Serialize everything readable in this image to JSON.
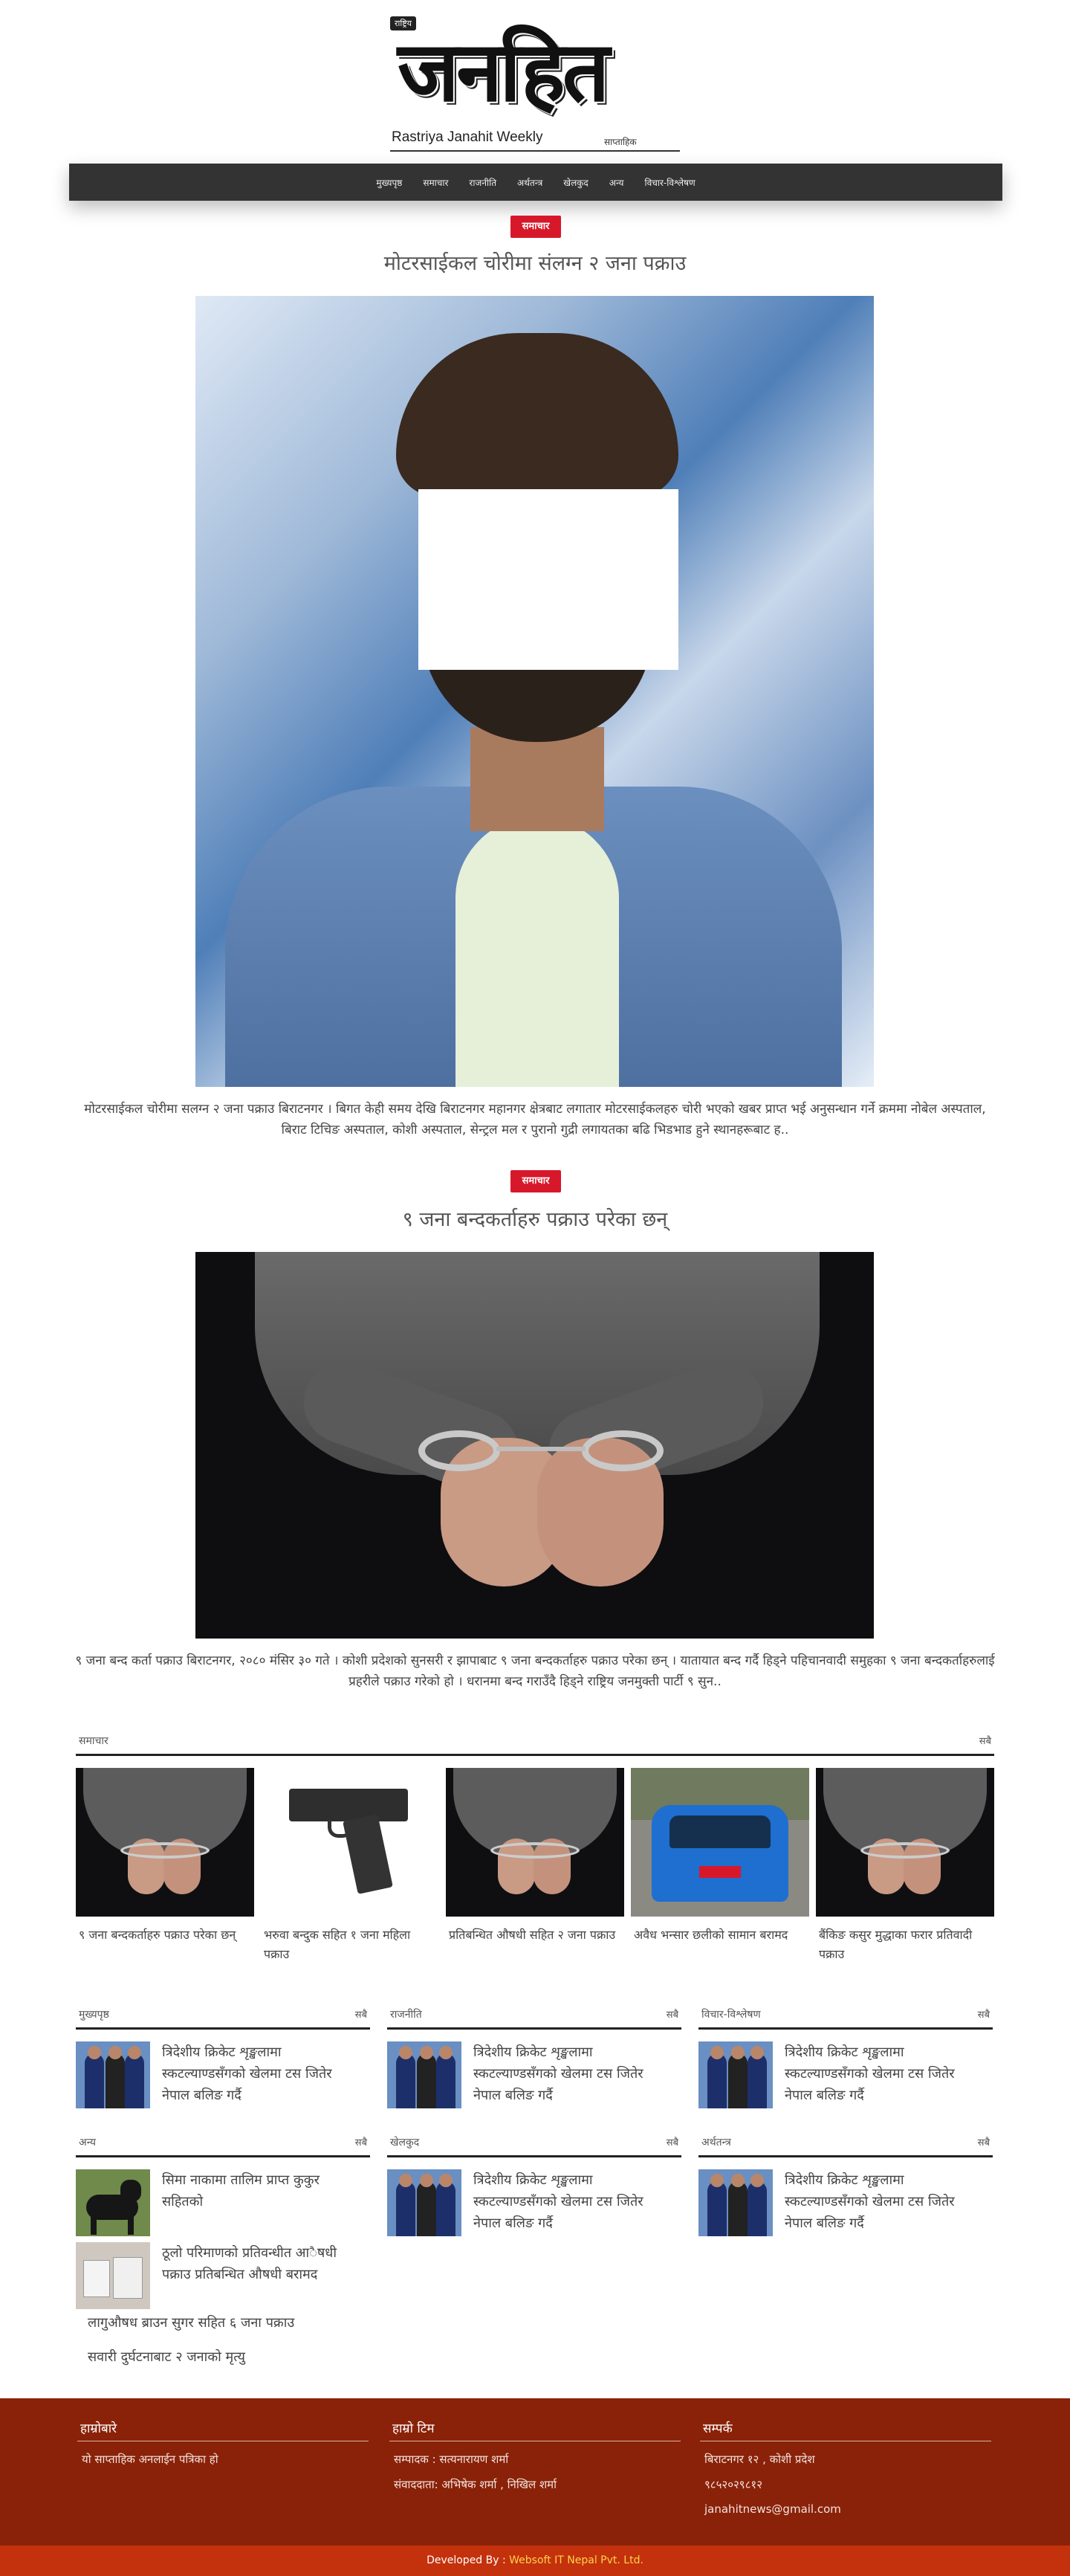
{
  "site": {
    "masthead_prefix": "राष्ट्रिय",
    "masthead_title": "जनहित",
    "masthead_subtitle": "Rastriya Janahit Weekly",
    "masthead_week": "साप्ताहिक"
  },
  "nav": {
    "items": [
      "मुख्यपृष्ठ",
      "समाचार",
      "राजनीति",
      "अर्थतन्त्र",
      "खेलकुद",
      "अन्य",
      "विचार-विश्लेषण"
    ]
  },
  "features": [
    {
      "category": "समाचार",
      "headline": "मोटरसाईकल चोरीमा संलग्न २ जना पक्राउ",
      "excerpt": "मोटरसाईकल चोरीमा सलग्न २ जना पक्राउ बिराटनगर । बिगत केही समय देखि  बिराटनगर महानगर क्षेत्रबाट लगातार मोटरसाईकलहरु चोरी भएको खबर प्राप्त भई अनुसन्धान गर्ने क्रममा नोबेल अस्पताल, बिराट टिचिङ अस्पताल, कोशी अस्पताल, सेन्ट्रल मल र पुरानो गुद्री लगायतका बढि भिडभाड हुने स्थानहरूबाट ह.."
    },
    {
      "category": "समाचार",
      "headline": "९ जना बन्दकर्ताहरु पक्राउ परेका छन्",
      "excerpt": "९ जना बन्द कर्ता पक्राउ   बिराटनगर, २०८० मंसिर ३० गते । कोशी प्रदेशको सुनसरी र झापाबाट ९ जना बन्दकर्ताहरु पक्राउ परेका छन् । यातायात बन्द गर्दै हिड्ने पहिचानवादी समुहका ९ जना बन्दकर्ताहरुलाई प्रहरीले पक्राउ गरेको हो । धरानमा बन्द गराउँदै हिड्ने  राष्ट्रिय जनमुक्ती पार्टी ९ सुन.."
    }
  ],
  "sections": {
    "news": {
      "title": "समाचार",
      "all_label": "सबै",
      "cards": [
        "९ जना बन्दकर्ताहरु पक्राउ परेका छन्",
        "भरुवा बन्दुक सहित १ जना महिला पक्राउ",
        "प्रतिबन्धित औषधी सहित २ जना पक्राउ",
        "अवैध भन्सार छलीको सामान बरामद",
        "बैंकिङ कसुर मुद्धाका फरार प्रतिवादी पक्राउ"
      ]
    },
    "homepage": {
      "title": "मुख्यपृष्ठ",
      "all_label": "सबै",
      "item": "त्रिदेशीय क्रिकेट शृङ्खलामा स्कटल्याण्डसँगको खेलमा टस जितेर नेपाल बलिङ गर्दै"
    },
    "politics": {
      "title": "राजनीति",
      "all_label": "सबै",
      "item": "त्रिदेशीय क्रिकेट शृङ्खलामा स्कटल्याण्डसँगको खेलमा टस जितेर नेपाल बलिङ गर्दै"
    },
    "opinion": {
      "title": "विचार-विश्लेषण",
      "all_label": "सबै",
      "item": "त्रिदेशीय क्रिकेट शृङ्खलामा स्कटल्याण्डसँगको खेलमा टस जितेर नेपाल बलिङ गर्दै"
    },
    "others": {
      "title": "अन्य",
      "all_label": "सबै",
      "items": [
        "सिमा नाकामा तालिम प्राप्त कुकुर सहितको",
        "ठूलो परिमाणको प्रतिवन्धीत आैषधी पक्राउ प्रतिबन्धित औषधी बरामद"
      ],
      "plain_items": [
        "लागुऔषध ब्राउन सुगर सहित ६ जना पक्राउ",
        "सवारी दुर्घटनाबाट २ जनाको मृत्यु"
      ]
    },
    "sports": {
      "title": "खेलकुद",
      "all_label": "सबै",
      "item": "त्रिदेशीय क्रिकेट शृङ्खलामा स्कटल्याण्डसँगको खेलमा टस जितेर नेपाल बलिङ गर्दै"
    },
    "economy": {
      "title": "अर्थतन्त्र",
      "all_label": "सबै",
      "item": "त्रिदेशीय क्रिकेट शृङ्खलामा स्कटल्याण्डसँगको खेलमा टस जितेर नेपाल बलिङ गर्दै"
    }
  },
  "footer": {
    "about": {
      "title": "हाम्रोबारे",
      "text": "यो साप्ताहिक अनलाईन पत्रिका हो"
    },
    "team": {
      "title": "हाम्रो टिम",
      "editor": "सम्पादक : सत्यनारायण शर्मा",
      "reporter": "संवाददाता: अभिषेक शर्मा , निखिल शर्मा"
    },
    "contact": {
      "title": "सम्पर्क",
      "address": "बिराटनगर १२ , कोशी प्रदेश",
      "phone": "९८५२०२९८१२",
      "email": "janahitnews@gmail.com"
    },
    "developed_by_label": "Developed By :",
    "developer": "Websoft IT Nepal Pvt. Ltd."
  },
  "colors": {
    "accent": "#d7182a",
    "nav": "#333333",
    "footer": "#8a2209",
    "bottom_bar": "#c3320c",
    "developer_link": "#ffd24a"
  }
}
